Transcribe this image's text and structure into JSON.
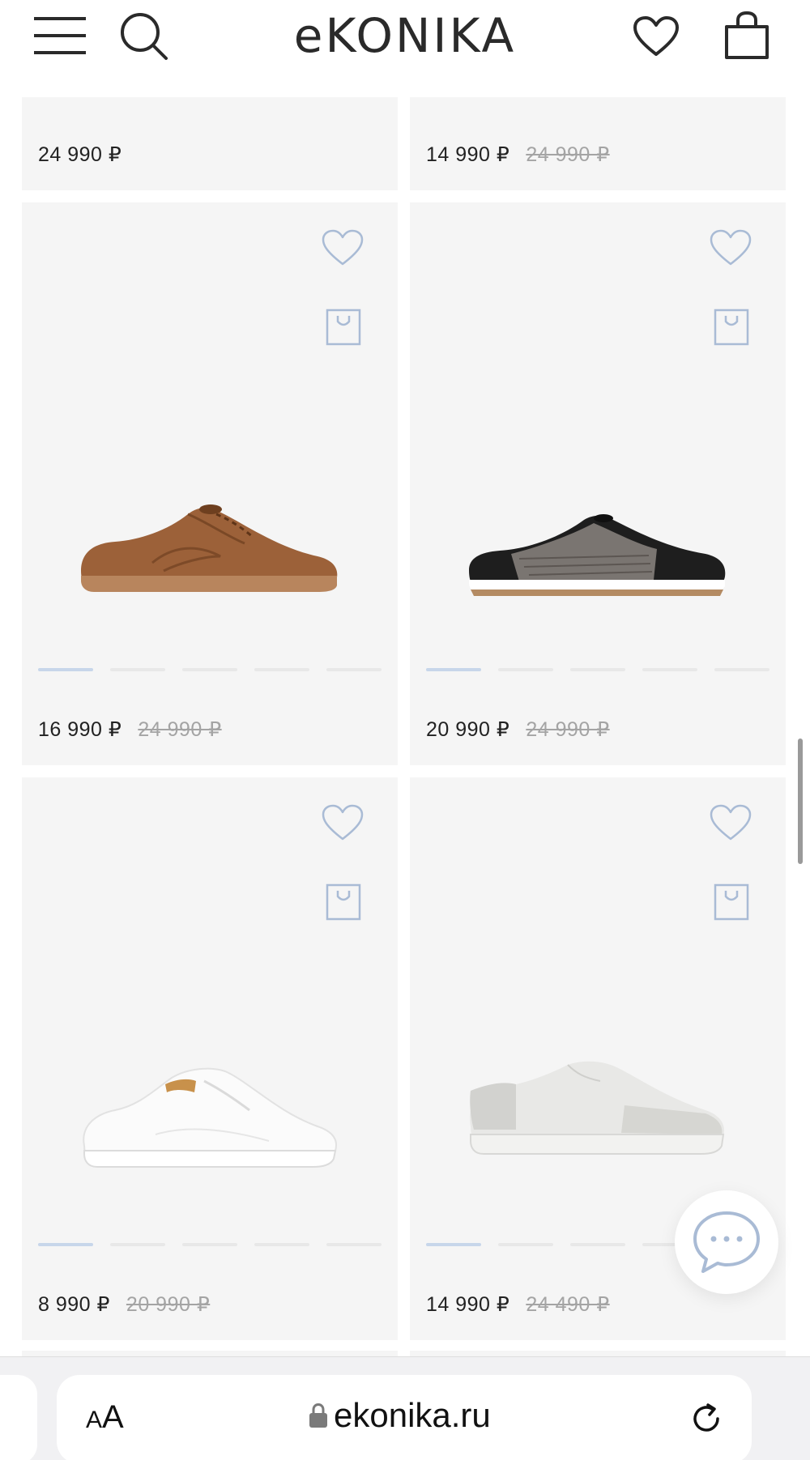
{
  "header": {
    "logo": "eKONIKA",
    "icons": [
      "menu-icon",
      "search-icon",
      "heart-icon",
      "shopping-bag-icon"
    ]
  },
  "products": [
    {
      "price": "24 990 ₽",
      "old_price": ""
    },
    {
      "price": "14 990 ₽",
      "old_price": "24 990 ₽"
    },
    {
      "price": "16 990 ₽",
      "old_price": "24 990 ₽",
      "image": "brown suede sneaker",
      "slides": 5,
      "active_slide": 1
    },
    {
      "price": "20 990 ₽",
      "old_price": "24 990 ₽",
      "image": "black mesh sneaker",
      "slides": 5,
      "active_slide": 1
    },
    {
      "price": "8 990 ₽",
      "old_price": "20 990 ₽",
      "image": "white leather sneaker",
      "slides": 5,
      "active_slide": 1
    },
    {
      "price": "14 990 ₽",
      "old_price": "24 490 ₽",
      "image": "light gray slip-on sneaker",
      "slides": 5,
      "active_slide": 1
    }
  ],
  "browser": {
    "text_size_small": "A",
    "text_size_large": "A",
    "url": "ekonika.ru"
  },
  "colors": {
    "accent": "#a9bbd5",
    "card_background": "#f5f5f5",
    "old_price": "#a4a4a4",
    "dot_active": "#c7d6ea"
  }
}
